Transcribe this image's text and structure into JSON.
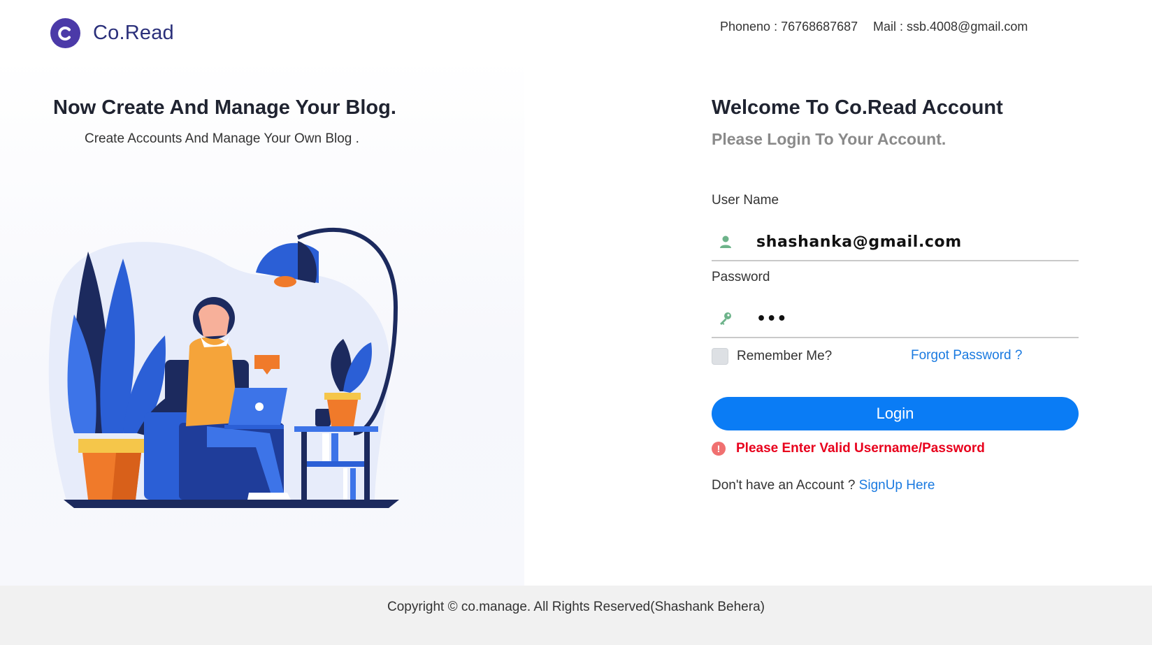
{
  "brand": {
    "name": "Co.Read",
    "logo_letter": "C",
    "logo_color": "#4b3aa8"
  },
  "contact": {
    "phone": "Phoneno : 76768687687",
    "mail": "Mail : ssb.4008@gmail.com"
  },
  "hero": {
    "title": "Now Create And Manage Your Blog.",
    "subtitle": "Create Accounts And Manage Your Own Blog ."
  },
  "login": {
    "welcome": "Welcome To Co.Read Account",
    "prompt": "Please Login To Your Account.",
    "username_label": "User Name",
    "username_value": "shashanka@gmail.com",
    "username_icon": "user-icon",
    "password_label": "Password",
    "password_value": "•••",
    "password_icon": "key-icon",
    "remember_label": "Remember Me?",
    "remember_checked": false,
    "forgot_label": "Forgot Password ?",
    "login_button": "Login",
    "error_icon": "!",
    "error_message": "Please Enter Valid Username/Password",
    "signup_prefix": "Don't have an Account ? ",
    "signup_link": "SignUp Here",
    "accent_color": "#0a7cf5",
    "error_color": "#e8001c"
  },
  "footer": {
    "copyright": "Copyright © co.manage. All Rights Reserved(Shashank Behera)"
  }
}
